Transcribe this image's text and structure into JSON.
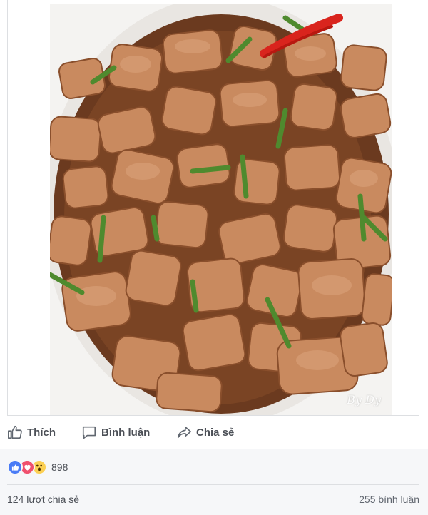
{
  "photo": {
    "description_icon": "food-photo-icon",
    "watermark": "By Dy"
  },
  "actions": {
    "like_label": "Thích",
    "comment_label": "Bình luận",
    "share_label": "Chia sẻ"
  },
  "reactions": {
    "icons": [
      "like-icon",
      "love-icon",
      "wow-icon"
    ],
    "count": "898"
  },
  "footer": {
    "shares": "124 lượt chia sẻ",
    "comments": "255 bình luận"
  },
  "colors": {
    "like_blue": "#4a7cf6",
    "love_red": "#f0506e",
    "wow_yellow": "#fcd053",
    "action_text": "#4b4f56"
  }
}
